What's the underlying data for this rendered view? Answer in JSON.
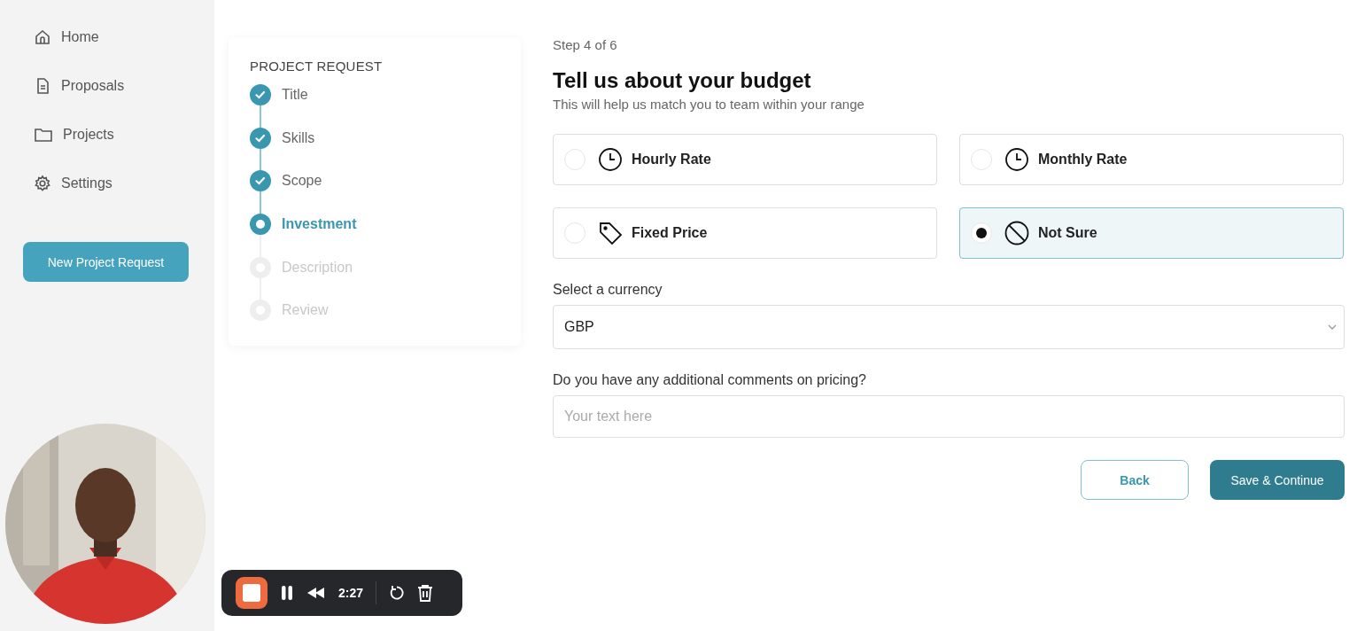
{
  "sidebar": {
    "items": [
      {
        "label": "Home",
        "kind": "home"
      },
      {
        "label": "Proposals",
        "kind": "document"
      },
      {
        "label": "Projects",
        "kind": "folder"
      },
      {
        "label": "Settings",
        "kind": "gear"
      }
    ],
    "button": "New Project Request"
  },
  "stepper": {
    "title": "PROJECT REQUEST",
    "steps": [
      {
        "label": "Title",
        "completed": true,
        "selected": false
      },
      {
        "label": "Skills",
        "completed": true,
        "selected": false
      },
      {
        "label": "Scope",
        "completed": true,
        "selected": false
      },
      {
        "label": "Investment",
        "completed": false,
        "selected": true
      },
      {
        "label": "Description",
        "completed": false,
        "selected": false
      },
      {
        "label": "Review",
        "completed": false,
        "selected": false
      }
    ]
  },
  "form": {
    "step": "Step 4 of 6",
    "heading": "Tell us about your budget",
    "subheading": "This will help us match you to team within your range",
    "options": [
      {
        "label": "Hourly Rate",
        "kind": "clock",
        "selected": false
      },
      {
        "label": "Monthly Rate",
        "kind": "clock",
        "selected": false
      },
      {
        "label": "Fixed Price",
        "kind": "tag",
        "selected": false
      },
      {
        "label": "Not Sure",
        "kind": "ban",
        "selected": true
      }
    ],
    "currency_label": "Select a currency",
    "currency": "GBP",
    "comments_label": "Do you have any additional comments on pricing?",
    "comments_placeholder": "Your text here",
    "back": "Back",
    "continue": "Save & Continue"
  },
  "recorder": {
    "time": "2:27"
  }
}
